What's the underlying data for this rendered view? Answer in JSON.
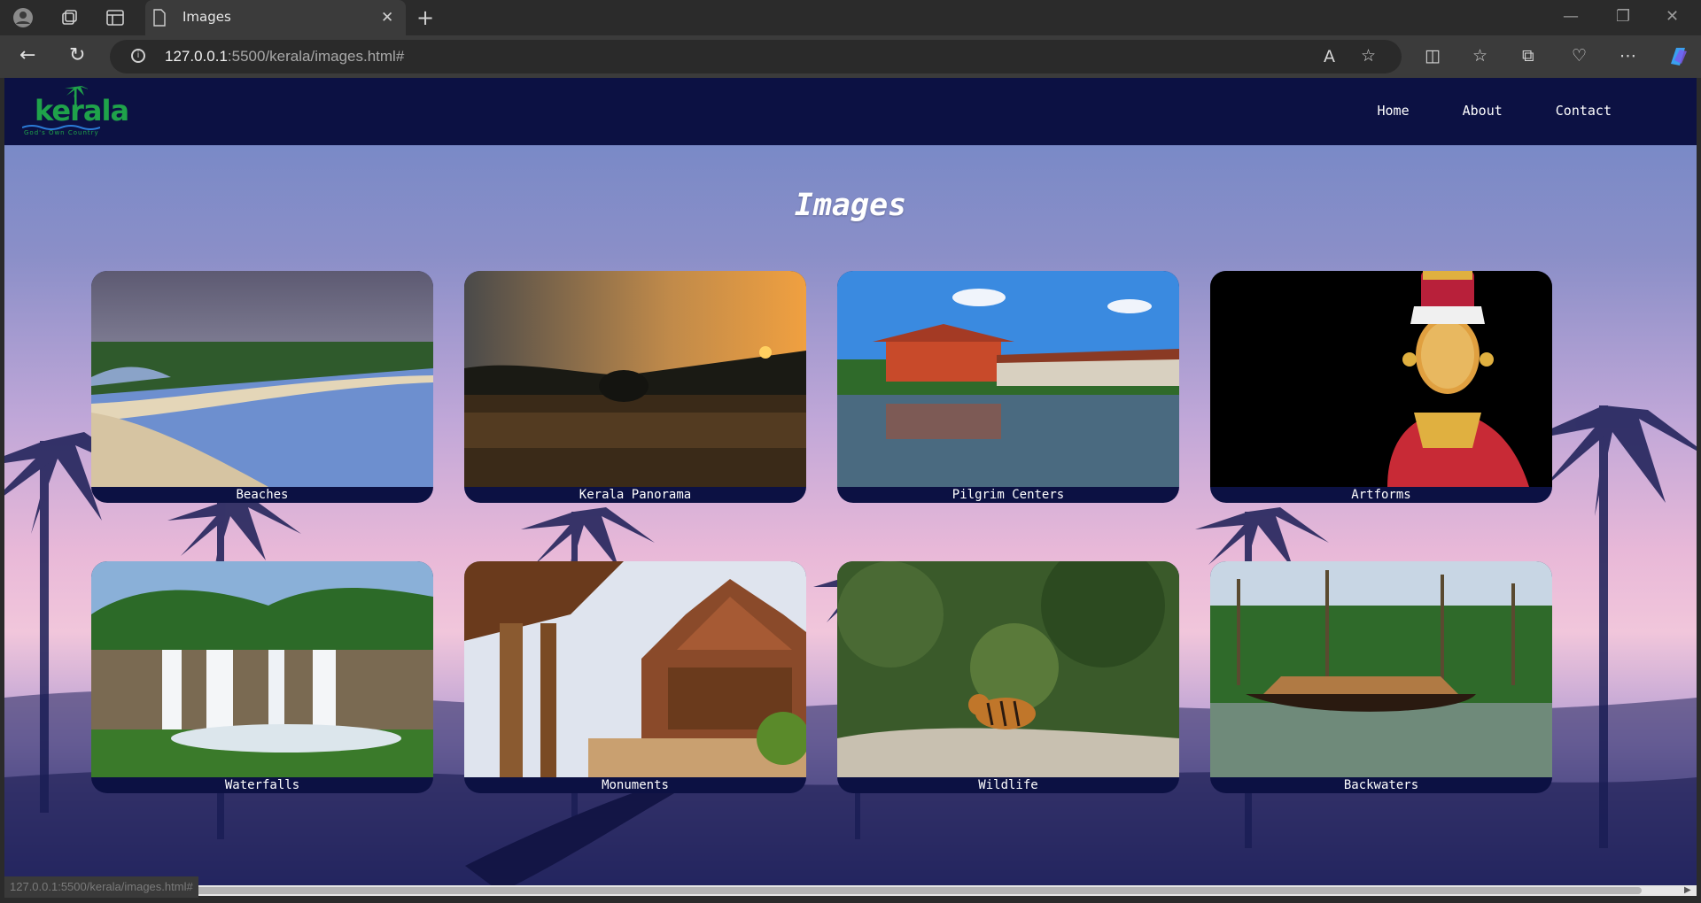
{
  "browser": {
    "tab_title": "Images",
    "url_host": "127.0.0.1",
    "url_rest": ":5500/kerala/images.html#",
    "status_url": "127.0.0.1:5500/kerala/images.html#"
  },
  "site": {
    "logo_text": "kerala",
    "logo_tagline": "God's Own Country",
    "nav": [
      "Home",
      "About",
      "Contact"
    ],
    "heading": "Images"
  },
  "gallery": [
    {
      "label": "Beaches"
    },
    {
      "label": "Kerala Panorama"
    },
    {
      "label": "Pilgrim Centers"
    },
    {
      "label": "Artforms"
    },
    {
      "label": "Waterfalls"
    },
    {
      "label": "Monuments"
    },
    {
      "label": "Wildlife"
    },
    {
      "label": "Backwaters"
    }
  ],
  "colors": {
    "navbar": "#0c1143",
    "accent_green": "#1fa24a"
  }
}
